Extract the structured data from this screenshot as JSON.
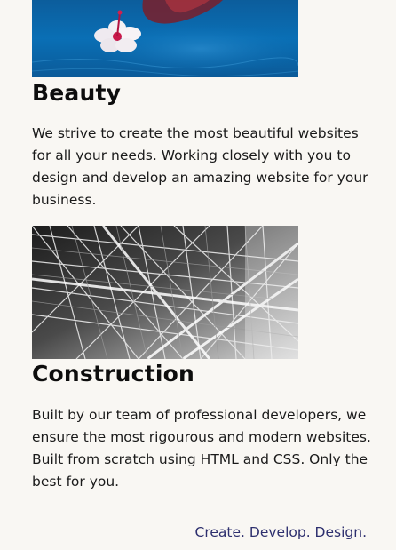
{
  "sections": [
    {
      "image_alt": "Hibiscus flower floating on blue water",
      "title": "Beauty",
      "text": "We strive to create the most beautiful websites for all your needs. Working closely with you to design and develop an amazing website for your business."
    },
    {
      "image_alt": "Black and white steel lattice structure",
      "title": "Construction",
      "text": "Built by our team of professional developers, we ensure the most rigourous and modern websites. Built from scratch using HTML and CSS. Only the best for you."
    }
  ],
  "footer": {
    "tagline": "Create. Develop. Design."
  },
  "colors": {
    "background": "#f9f7f3",
    "heading": "#0d0d0d",
    "body_text": "#1a1a1a",
    "tagline": "#2d2f6e",
    "water": "#0a6fb5"
  }
}
